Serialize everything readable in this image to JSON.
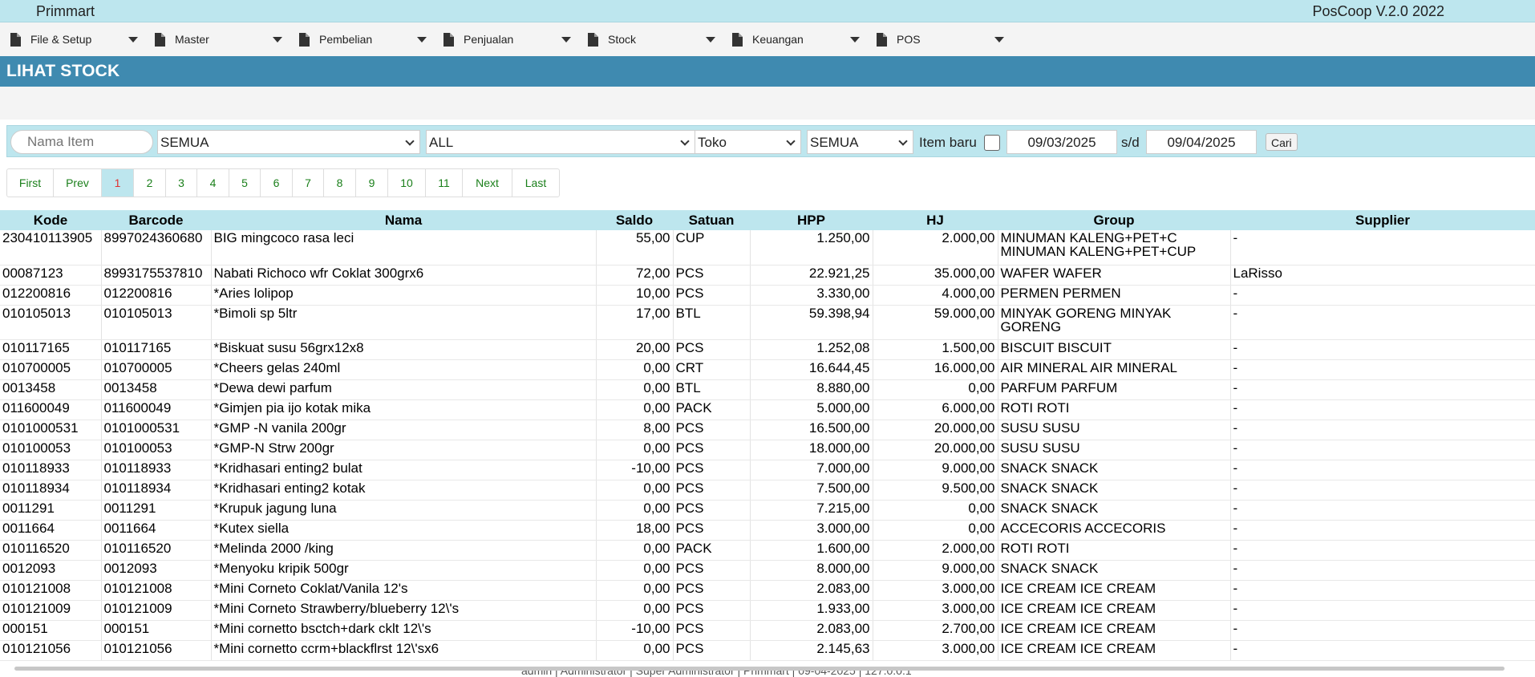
{
  "header": {
    "app_name": "Primmart",
    "version": "PosCoop V.2.0 2022"
  },
  "menu": [
    {
      "label": "File & Setup",
      "icon": "document-icon"
    },
    {
      "label": "Master",
      "icon": "document-icon"
    },
    {
      "label": "Pembelian",
      "icon": "document-icon"
    },
    {
      "label": "Penjualan",
      "icon": "document-icon"
    },
    {
      "label": "Stock",
      "icon": "document-icon"
    },
    {
      "label": "Keuangan",
      "icon": "document-icon"
    },
    {
      "label": "POS",
      "icon": "document-icon"
    }
  ],
  "page_title": "LIHAT STOCK",
  "filters": {
    "search_placeholder": "Nama Item",
    "select1": "SEMUA",
    "select2": "ALL",
    "select3": "Toko",
    "select4": "SEMUA",
    "item_baru_label": "Item baru",
    "item_baru_checked": false,
    "date_from": "09/03/2025",
    "sd_label": "s/d",
    "date_to": "09/04/2025",
    "search_button": "Cari"
  },
  "pagination": [
    "First",
    "Prev",
    "1",
    "2",
    "3",
    "4",
    "5",
    "6",
    "7",
    "8",
    "9",
    "10",
    "11",
    "Next",
    "Last"
  ],
  "pagination_active": "1",
  "table": {
    "headers": [
      "Kode",
      "Barcode",
      "Nama",
      "Saldo",
      "Satuan",
      "HPP",
      "HJ",
      "Group",
      "Supplier"
    ],
    "rows": [
      [
        "230410113905",
        "8997024360680",
        "BIG mingcoco rasa leci",
        "55,00",
        "CUP",
        "1.250,00",
        "2.000,00",
        "MINUMAN KALENG+PET+C MINUMAN KALENG+PET+CUP",
        "-"
      ],
      [
        "00087123",
        "8993175537810",
        "Nabati Richoco wfr Coklat 300grx6",
        "72,00",
        "PCS",
        "22.921,25",
        "35.000,00",
        "WAFER WAFER",
        "LaRisso"
      ],
      [
        "012200816",
        "012200816",
        "*Aries lolipop",
        "10,00",
        "PCS",
        "3.330,00",
        "4.000,00",
        "PERMEN PERMEN",
        "-"
      ],
      [
        "010105013",
        "010105013",
        "*Bimoli sp 5ltr",
        "17,00",
        "BTL",
        "59.398,94",
        "59.000,00",
        "MINYAK GORENG MINYAK GORENG",
        "-"
      ],
      [
        "010117165",
        "010117165",
        "*Biskuat susu 56grx12x8",
        "20,00",
        "PCS",
        "1.252,08",
        "1.500,00",
        "BISCUIT BISCUIT",
        "-"
      ],
      [
        "010700005",
        "010700005",
        "*Cheers gelas 240ml",
        "0,00",
        "CRT",
        "16.644,45",
        "16.000,00",
        "AIR MINERAL AIR MINERAL",
        "-"
      ],
      [
        "0013458",
        "0013458",
        "*Dewa dewi parfum",
        "0,00",
        "BTL",
        "8.880,00",
        "0,00",
        "PARFUM PARFUM",
        "-"
      ],
      [
        "011600049",
        "011600049",
        "*Gimjen pia ijo kotak mika",
        "0,00",
        "PACK",
        "5.000,00",
        "6.000,00",
        "ROTI ROTI",
        "-"
      ],
      [
        "0101000531",
        "0101000531",
        "*GMP -N vanila 200gr",
        "8,00",
        "PCS",
        "16.500,00",
        "20.000,00",
        "SUSU SUSU",
        "-"
      ],
      [
        "010100053",
        "010100053",
        "*GMP-N Strw 200gr",
        "0,00",
        "PCS",
        "18.000,00",
        "20.000,00",
        "SUSU SUSU",
        "-"
      ],
      [
        "010118933",
        "010118933",
        "*Kridhasari enting2 bulat",
        "-10,00",
        "PCS",
        "7.000,00",
        "9.000,00",
        "SNACK SNACK",
        "-"
      ],
      [
        "010118934",
        "010118934",
        "*Kridhasari enting2 kotak",
        "0,00",
        "PCS",
        "7.500,00",
        "9.500,00",
        "SNACK SNACK",
        "-"
      ],
      [
        "0011291",
        "0011291",
        "*Krupuk jagung luna",
        "0,00",
        "PCS",
        "7.215,00",
        "0,00",
        "SNACK SNACK",
        "-"
      ],
      [
        "0011664",
        "0011664",
        "*Kutex siella",
        "18,00",
        "PCS",
        "3.000,00",
        "0,00",
        "ACCECORIS ACCECORIS",
        "-"
      ],
      [
        "010116520",
        "010116520",
        "*Melinda 2000 /king",
        "0,00",
        "PACK",
        "1.600,00",
        "2.000,00",
        "ROTI ROTI",
        "-"
      ],
      [
        "0012093",
        "0012093",
        "*Menyoku kripik 500gr",
        "0,00",
        "PCS",
        "8.000,00",
        "9.000,00",
        "SNACK SNACK",
        "-"
      ],
      [
        "010121008",
        "010121008",
        "*Mini Corneto Coklat/Vanila 12's",
        "0,00",
        "PCS",
        "2.083,00",
        "3.000,00",
        "ICE CREAM ICE CREAM",
        "-"
      ],
      [
        "010121009",
        "010121009",
        "*Mini Corneto Strawberry/blueberry 12\\'s",
        "0,00",
        "PCS",
        "1.933,00",
        "3.000,00",
        "ICE CREAM ICE CREAM",
        "-"
      ],
      [
        "000151",
        "000151",
        "*Mini cornetto bsctch+dark cklt 12\\'s",
        "-10,00",
        "PCS",
        "2.083,00",
        "2.700,00",
        "ICE CREAM ICE CREAM",
        "-"
      ],
      [
        "010121056",
        "010121056",
        "*Mini cornetto ccrm+blackflrst 12\\'sx6",
        "0,00",
        "PCS",
        "2.145,63",
        "3.000,00",
        "ICE CREAM ICE CREAM",
        "-"
      ]
    ]
  },
  "status": "admin | Administrator | Super Administrator | Primmart | 09-04-2025 | 127.0.0.1"
}
